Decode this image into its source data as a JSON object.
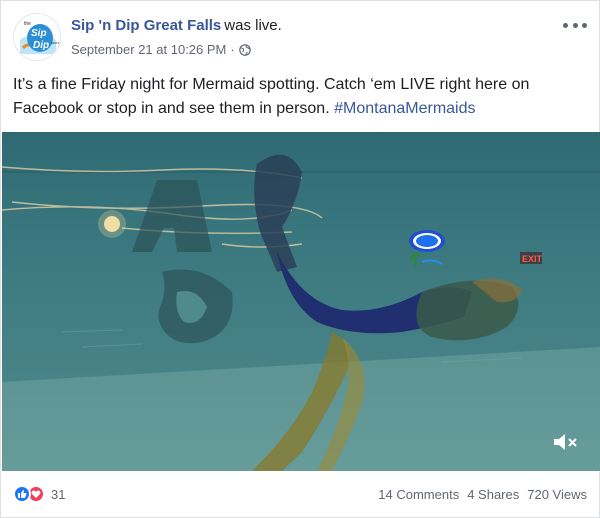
{
  "post": {
    "page_name": "Sip 'n Dip Great Falls",
    "status_text": "was live.",
    "timestamp": "September 21 at 10:26 PM",
    "separator": "·",
    "audience_icon": "globe-icon",
    "more_icon": "more-options-icon",
    "text": "It’s a fine Friday night for Mermaid spotting. Catch ‘em LIVE right here on Facebook or stop in and see them in person.",
    "hashtag": "#MontanaMermaids"
  },
  "avatar": {
    "logo_small_top": "the",
    "logo_line1": "Sip",
    "logo_line2": "Dip",
    "logo_small_side": "lounge"
  },
  "video": {
    "exit_sign": "EXIT",
    "mute_icon": "muted-speaker-icon"
  },
  "footer": {
    "reaction_icons": [
      "like-icon",
      "love-icon"
    ],
    "reaction_count": "31",
    "comments": "14 Comments",
    "shares": "4 Shares",
    "views": "720 Views"
  },
  "colors": {
    "link_blue": "#385898",
    "like_blue": "#1877f2",
    "love_red": "#f33e58",
    "water_teal": "#3e7a7f"
  }
}
